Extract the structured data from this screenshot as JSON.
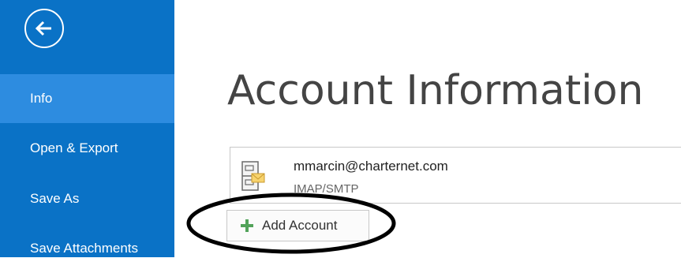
{
  "sidebar": {
    "back_icon": "back-arrow-icon",
    "items": [
      {
        "label": "Info",
        "active": true
      },
      {
        "label": "Open & Export",
        "active": false
      },
      {
        "label": "Save As",
        "active": false
      },
      {
        "label": "Save Attachments",
        "active": false
      }
    ]
  },
  "main": {
    "title": "Account Information",
    "account": {
      "email": "mmarcin@charternet.com",
      "type": "IMAP/SMTP",
      "icon": "account-cabinet-icon"
    },
    "add_account": {
      "label": "Add Account",
      "icon": "plus-icon"
    }
  },
  "colors": {
    "sidebar_bg": "#0a72c6",
    "sidebar_active": "#2d8ce0",
    "plus_green": "#52a35a",
    "annotation": "#000000"
  }
}
